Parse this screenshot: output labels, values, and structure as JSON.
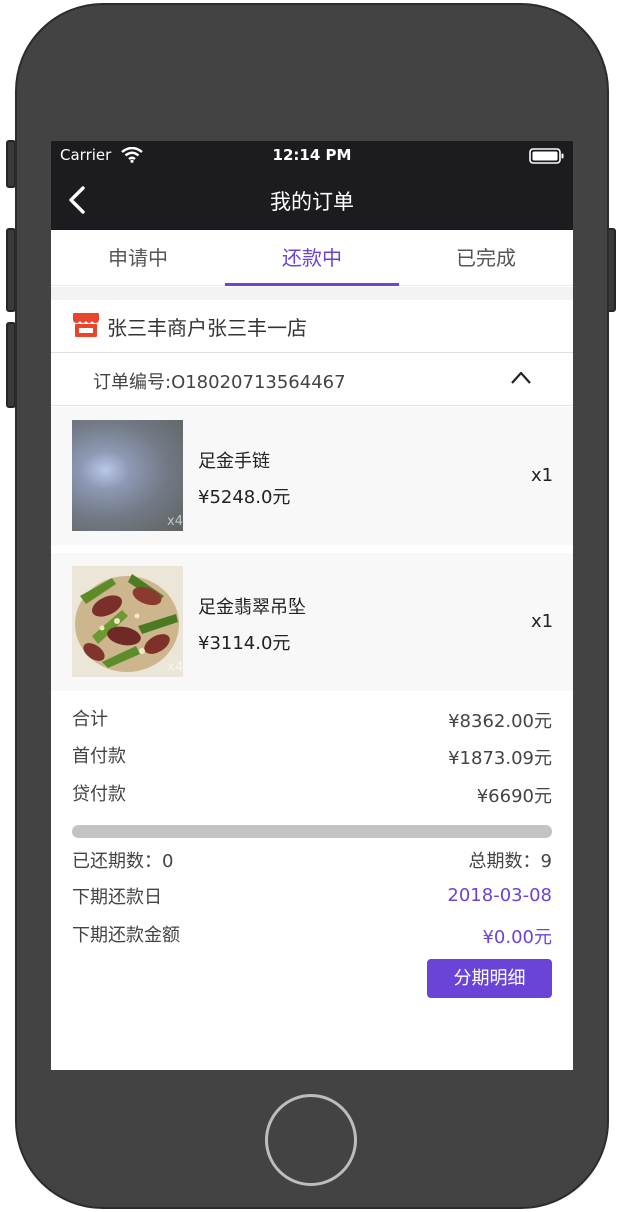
{
  "status_bar": {
    "carrier": "Carrier",
    "time": "12:14 PM"
  },
  "nav": {
    "title": "我的订单"
  },
  "tabs": [
    {
      "label": "申请中"
    },
    {
      "label": "还款中"
    },
    {
      "label": "已完成"
    }
  ],
  "selected_tab": "还款中",
  "store": {
    "name": "张三丰商户张三丰一店"
  },
  "order": {
    "number_label": "订单编号:O18020713564467"
  },
  "items": [
    {
      "name": "足金手链",
      "price": "¥5248.0元",
      "qty": "x1",
      "watermark": "x4"
    },
    {
      "name": "足金翡翠吊坠",
      "price": "¥3114.0元",
      "qty": "x1",
      "watermark": "x4"
    }
  ],
  "summary": {
    "total_label": "合计",
    "total_value": "¥8362.00元",
    "down_label": "首付款",
    "down_value": "¥1873.09元",
    "loan_label": "贷付款",
    "loan_value": "¥6690元"
  },
  "repayment": {
    "progress": 0,
    "paid_label": "已还期数：0",
    "total_periods_label": "总期数：9",
    "next_date_label": "下期还款日",
    "next_date_value": "2018-03-08",
    "next_amount_label": "下期还款金额",
    "next_amount_value": "¥0.00元"
  },
  "detail_button": "分期明细",
  "colors": {
    "accent": "#6a44d6",
    "nav_bg": "#1c1b20",
    "store_icon": "#e8452c"
  },
  "icons": {
    "back": "chevron-left-icon",
    "collapse": "chevron-up-icon",
    "store": "shop-icon",
    "wifi": "wifi-icon",
    "battery": "battery-icon"
  }
}
